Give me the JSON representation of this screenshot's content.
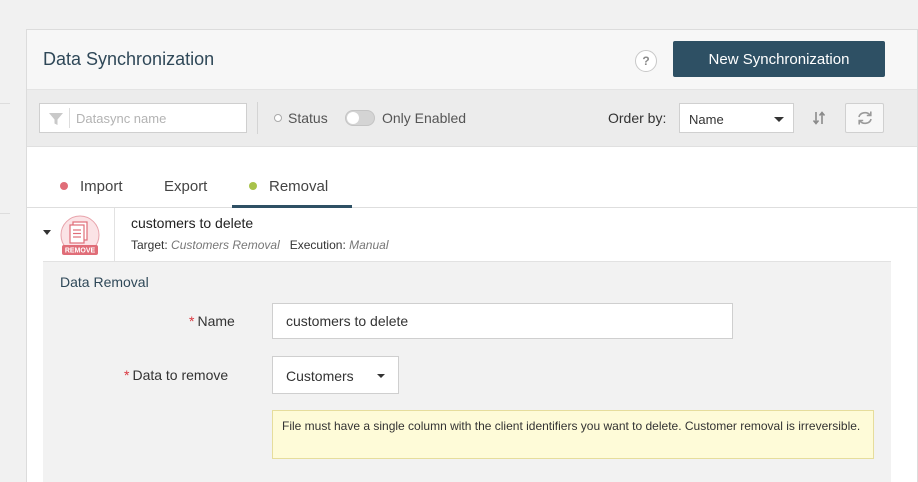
{
  "header": {
    "title": "Data Synchronization",
    "help_label": "?",
    "new_button_label": "New Synchronization"
  },
  "toolbar": {
    "search_placeholder": "Datasync name",
    "status_label": "Status",
    "only_enabled_label": "Only Enabled",
    "only_enabled_on": false,
    "order_by_label": "Order by:",
    "order_by_value": "Name"
  },
  "tabs": [
    {
      "label": "Import",
      "dot_color": "#e06d78"
    },
    {
      "label": "Export"
    },
    {
      "label": "Removal",
      "dot_color": "#a8c24a",
      "active": true
    }
  ],
  "item": {
    "name": "customers to delete",
    "icon_badge": "REMOVE",
    "target_label": "Target:",
    "target_value": "Customers Removal",
    "execution_label": "Execution:",
    "execution_value": "Manual"
  },
  "form": {
    "section_title": "Data Removal",
    "required_mark": "*",
    "name_label": "Name",
    "name_value": "customers to delete",
    "data_label": "Data to remove",
    "data_value": "Customers",
    "notice": "File must have a single column with the client identifiers you want to delete. Customer removal is irreversible."
  },
  "colors": {
    "primary": "#2e5064",
    "import_dot": "#e06d78",
    "removal_dot": "#a8c24a",
    "required": "#d9363e",
    "notice_bg": "#fefbd8"
  }
}
